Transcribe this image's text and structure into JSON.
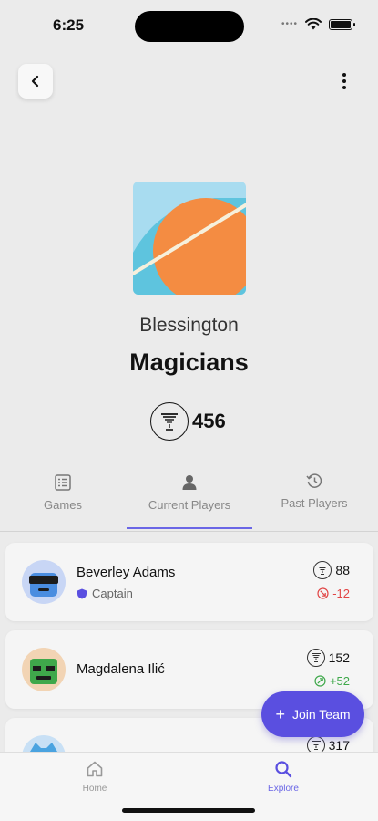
{
  "status_bar": {
    "time": "6:25",
    "signal": "••••"
  },
  "team": {
    "city": "Blessington",
    "name": "Magicians",
    "rating": "456"
  },
  "tabs": [
    {
      "label": "Games",
      "icon": "list-icon"
    },
    {
      "label": "Current Players",
      "icon": "person-icon",
      "active": true
    },
    {
      "label": "Past Players",
      "icon": "history-icon"
    }
  ],
  "players": [
    {
      "name": "Beverley Adams",
      "role": "Captain",
      "rating": "88",
      "delta": "-12",
      "delta_status": "negative",
      "avatar_color": "#4a8de0"
    },
    {
      "name": "Magdalena Ilić",
      "rating": "152",
      "delta": "+52",
      "delta_status": "positive",
      "avatar_color": "#3fa84b"
    },
    {
      "rating": "317",
      "avatar_color": "#4aa3e0"
    }
  ],
  "join_button": {
    "label": "Join Team"
  },
  "bottom_nav": [
    {
      "label": "Home",
      "icon": "home-icon"
    },
    {
      "label": "Explore",
      "icon": "search-icon",
      "active": true
    }
  ],
  "colors": {
    "accent": "#5a4fe0",
    "negative": "#e14646",
    "positive": "#3fa84b",
    "background": "#ebebeb"
  }
}
